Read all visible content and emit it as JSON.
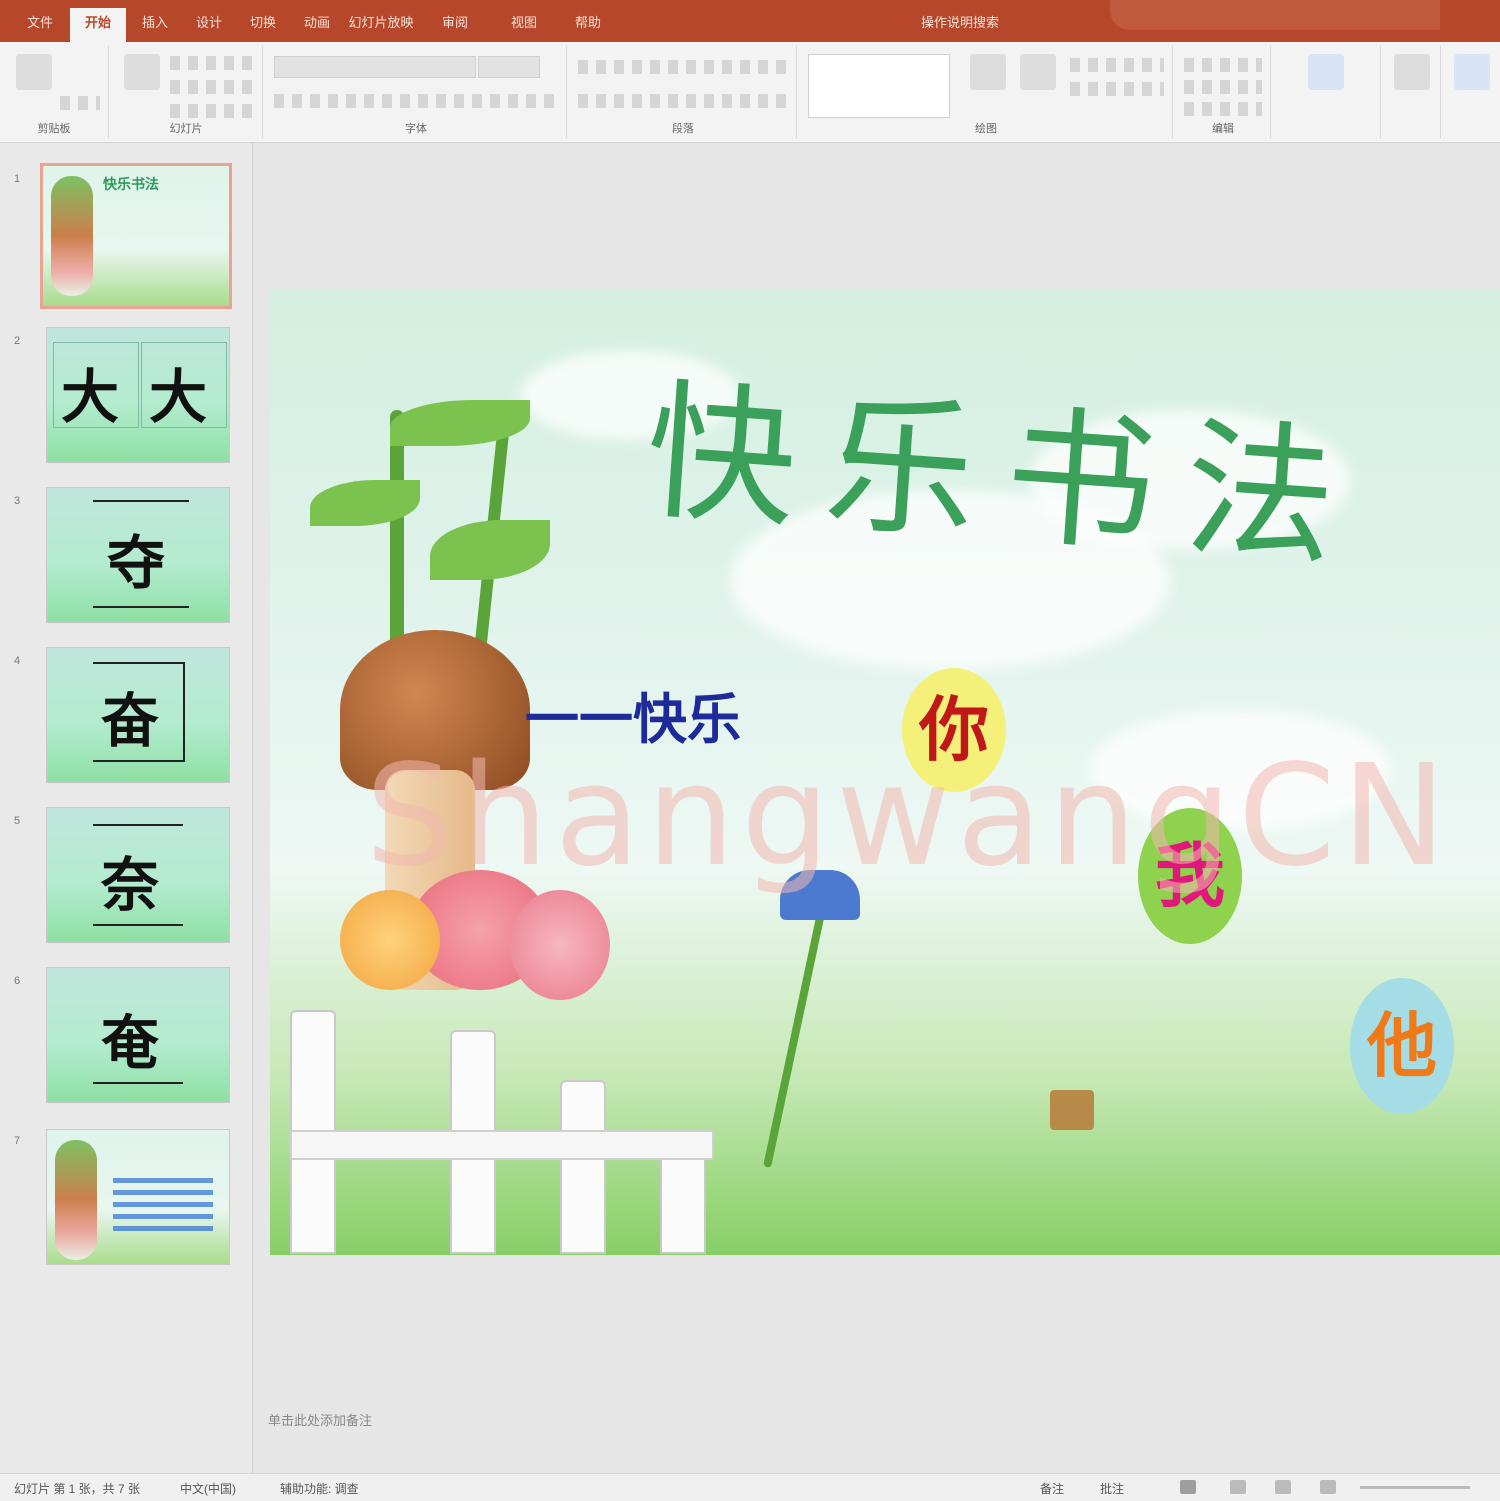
{
  "window": {
    "tabs": [
      "文件",
      "开始",
      "插入",
      "设计",
      "切换",
      "动画",
      "幻灯片放映",
      "审阅",
      "视图",
      "帮助",
      "操作说明搜索"
    ],
    "active_tab_index": 1,
    "accent_color": "#b7472a"
  },
  "ribbon": {
    "groups": [
      "剪贴板",
      "幻灯片",
      "字体",
      "段落",
      "绘图",
      "编辑"
    ]
  },
  "thumbnails": [
    {
      "number": "1",
      "kind": "title-scene",
      "text": "快乐书法"
    },
    {
      "number": "2",
      "kind": "chars",
      "text": [
        "大",
        "大"
      ]
    },
    {
      "number": "3",
      "kind": "char",
      "text": "夺"
    },
    {
      "number": "4",
      "kind": "char",
      "text": "奋"
    },
    {
      "number": "5",
      "kind": "char",
      "text": "奈"
    },
    {
      "number": "6",
      "kind": "char",
      "text": "奄"
    },
    {
      "number": "7",
      "kind": "list-scene",
      "text": ""
    }
  ],
  "slide": {
    "title": "快乐书法",
    "subtitle": "一一快乐",
    "bubbles": [
      {
        "text": "你",
        "bg": "#f4f07a",
        "color": "#c01818"
      },
      {
        "text": "我",
        "bg": "#8fd24e",
        "color": "#e0187a"
      },
      {
        "text": "他",
        "bg": "#a4dde6",
        "color": "#f07a18"
      }
    ],
    "watermark": "ShangwangCN",
    "title_color": "#3aa05a",
    "subtitle_color": "#1c2a9a"
  },
  "notes": {
    "placeholder": "单击此处添加备注"
  },
  "statusbar": {
    "left": [
      "幻灯片 第 1 张，共 7 张",
      "中文(中国)",
      "辅助功能: 调查"
    ],
    "right": [
      "备注",
      "批注"
    ]
  }
}
